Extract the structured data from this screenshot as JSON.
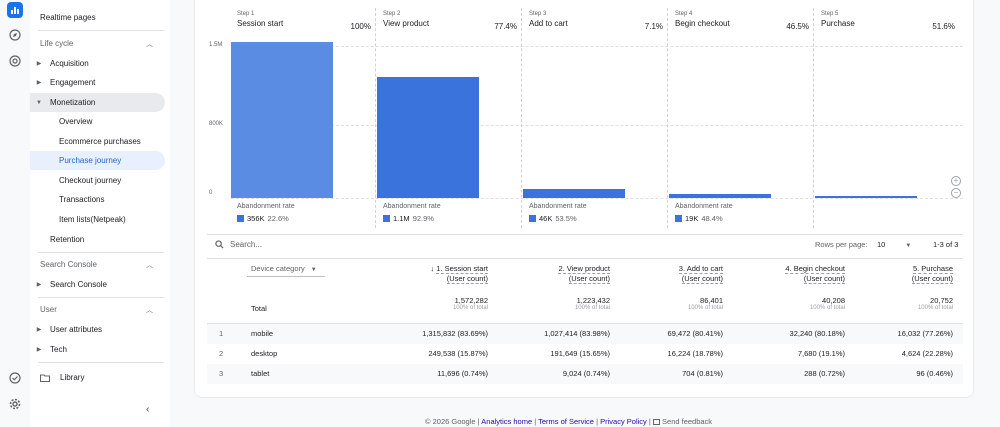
{
  "sidebar": {
    "top_items": [
      "Realtime pages"
    ],
    "lifecycle_label": "Life cycle",
    "acquisition": "Acquisition",
    "engagement": "Engagement",
    "monetization": "Monetization",
    "monetization_children": [
      "Overview",
      "Ecommerce purchases",
      "Purchase journey",
      "Checkout journey",
      "Transactions",
      "Item lists(Netpeak)"
    ],
    "retention": "Retention",
    "search_console_label": "Search Console",
    "search_console_item": "Search Console",
    "user_label": "User",
    "user_attributes": "User attributes",
    "tech": "Tech",
    "library": "Library",
    "active_item": "Purchase journey"
  },
  "funnel": {
    "steps": [
      {
        "num": "Step 1",
        "name": "Session start",
        "pct": "100%",
        "aband_label": "Abandonment rate",
        "aband_val": "356K",
        "aband_pct": "22.6%"
      },
      {
        "num": "Step 2",
        "name": "View product",
        "pct": "77.4%",
        "aband_label": "Abandonment rate",
        "aband_val": "1.1M",
        "aband_pct": "92.9%"
      },
      {
        "num": "Step 3",
        "name": "Add to cart",
        "pct": "7.1%",
        "aband_label": "Abandonment rate",
        "aband_val": "46K",
        "aband_pct": "53.5%"
      },
      {
        "num": "Step 4",
        "name": "Begin checkout",
        "pct": "46.5%",
        "aband_label": "Abandonment rate",
        "aband_val": "19K",
        "aband_pct": "48.4%"
      },
      {
        "num": "Step 5",
        "name": "Purchase",
        "pct": "51.6%",
        "aband_label": "",
        "aband_val": "",
        "aband_pct": ""
      }
    ],
    "yticks": [
      "1.5M",
      "800K",
      "0"
    ],
    "bar_fractions": [
      1.0,
      0.774,
      0.055,
      0.025,
      0.013
    ]
  },
  "table": {
    "search_placeholder": "Search...",
    "rows_per_page_label": "Rows per page:",
    "rows_per_page": "10",
    "pagination": "1-3 of 3",
    "dimension": "Device category",
    "columns": [
      {
        "title": "1. Session start",
        "sub": "(User count)"
      },
      {
        "title": "2. View product",
        "sub": "(User count)"
      },
      {
        "title": "3. Add to cart",
        "sub": "(User count)"
      },
      {
        "title": "4. Begin checkout",
        "sub": "(User count)"
      },
      {
        "title": "5. Purchase",
        "sub": "(User count)"
      }
    ],
    "total_label": "Total",
    "totals": [
      "1,572,282",
      "1,223,432",
      "86,401",
      "40,208",
      "20,752"
    ],
    "total_sub": "100% of total",
    "rows": [
      {
        "idx": "1",
        "name": "mobile",
        "vals": [
          "1,315,832 (83.69%)",
          "1,027,414 (83.98%)",
          "69,472 (80.41%)",
          "32,240 (80.18%)",
          "16,032 (77.26%)"
        ]
      },
      {
        "idx": "2",
        "name": "desktop",
        "vals": [
          "249,538 (15.87%)",
          "191,649 (15.65%)",
          "16,224 (18.78%)",
          "7,680 (19.1%)",
          "4,624 (22.28%)"
        ]
      },
      {
        "idx": "3",
        "name": "tablet",
        "vals": [
          "11,696 (0.74%)",
          "9,024 (0.74%)",
          "704 (0.81%)",
          "288 (0.72%)",
          "96 (0.46%)"
        ]
      }
    ]
  },
  "footer": {
    "copyright": "© 2026 Google |",
    "analytics_home": "Analytics home",
    "terms": "Terms of Service",
    "privacy": "Privacy Policy",
    "feedback": "Send feedback"
  },
  "colors": {
    "accent": "#1a73e8",
    "bar": "#3b73dd",
    "active_bg": "#e8f0fe"
  }
}
